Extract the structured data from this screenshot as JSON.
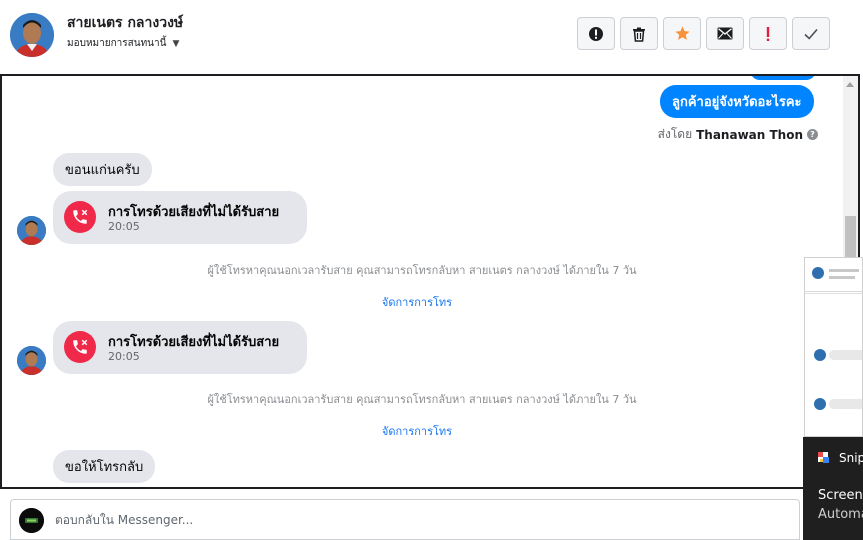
{
  "header": {
    "contact_name": "สายเนตร กลางวงษ์",
    "assign_label": "มอบหมายการสนทนานี้",
    "actions": [
      {
        "name": "spam-button",
        "icon": "alert-circle-icon"
      },
      {
        "name": "delete-button",
        "icon": "trash-icon"
      },
      {
        "name": "star-button",
        "icon": "star-icon",
        "color": "#f7923b"
      },
      {
        "name": "mark-unread-button",
        "icon": "envelope-icon"
      },
      {
        "name": "follow-up-button",
        "icon": "exclamation-icon",
        "color": "#e41e3f"
      },
      {
        "name": "mark-done-button",
        "icon": "checkmark-icon"
      }
    ]
  },
  "messages": {
    "outgoing_text": "ลูกค้าอยู่จังหวัดอะไรคะ",
    "sent_by_prefix": "ส่งโดย",
    "sent_by_name": "Thanawan Thon",
    "incoming_1": "ขอนแก่นครับ",
    "call_1": {
      "title": "การโทรด้วยเสียงที่ไม่ได้รับสาย",
      "time": "20:05"
    },
    "note_1": "ผู้ใช้โทรหาคุณนอกเวลารับสาย คุณสามารถโทรกลับหา สายเนตร กลางวงษ์ ได้ภายใน 7 วัน",
    "manage_1": "จัดการการโทร",
    "call_2": {
      "title": "การโทรด้วยเสียงที่ไม่ได้รับสาย",
      "time": "20:05"
    },
    "note_2": "ผู้ใช้โทรหาคุณนอกเวลารับสาย คุณสามารถโทรกลับหา สายเนตร กลางวงษ์ ได้ภายใน 7 วัน",
    "manage_2": "จัดการการโทร",
    "incoming_2": "ขอให้โทรกลับ"
  },
  "reply": {
    "placeholder": "ตอบกลับใน Messenger..."
  },
  "toast": {
    "app_name": "Snip",
    "title": "Screens",
    "body": "Automa"
  },
  "colors": {
    "brand_blue": "#0084ff",
    "missed_call_red": "#f02849",
    "link_blue": "#1877f2"
  }
}
